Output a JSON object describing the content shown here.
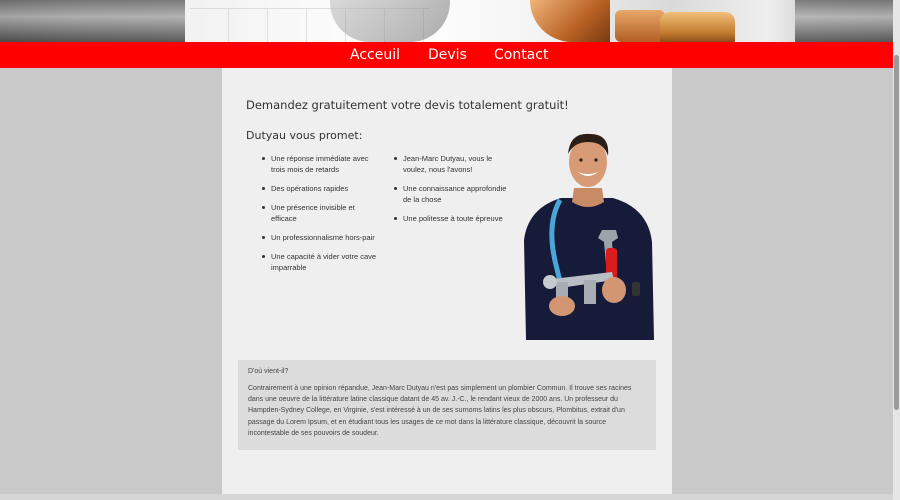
{
  "nav": {
    "items": [
      "Acceuil",
      "Devis",
      "Contact"
    ]
  },
  "content": {
    "headline": "Demandez gratuitement votre devis totalement gratuit!",
    "promise_title": "Dutyau vous promet:",
    "left_list": [
      "Une réponse immédiate avec trois mois de retards",
      "Des opérations rapides",
      "Une présence invisible et efficace",
      "Un professionnalisme hors-pair",
      "Une capacité à vider votre cave imparrable"
    ],
    "right_list": [
      "Jean-Marc Dutyau, vous le voulez, nous l'avons!",
      "Une connaissance approfondie de la chose",
      "Une politesse à toute épreuve"
    ]
  },
  "info": {
    "title": "D'où vient-il?",
    "text": "Contrairement à une opinion répandue, Jean-Marc Dutyau n'est pas simplement un plombier Commun. Il trouve ses racines dans une oeuvre de la littérature latine classique datant de 45 av. J.-C., le rendant vieux de 2000 ans. Un professeur du Hampden-Sydney College, en Virginie, s'est intéressé à un de ses surnoms latins les plus obscurs, Plombitus, extrait d'un passage du Lorem Ipsum, et en étudiant tous les usages de ce mot dans la littérature classique, découvrit la source incontestable de ses pouvoirs de soudeur."
  },
  "colors": {
    "nav": "#ff0000",
    "page_bg": "#c9c9c9",
    "content_bg": "#efefef",
    "info_bg": "#dcdcdc"
  }
}
